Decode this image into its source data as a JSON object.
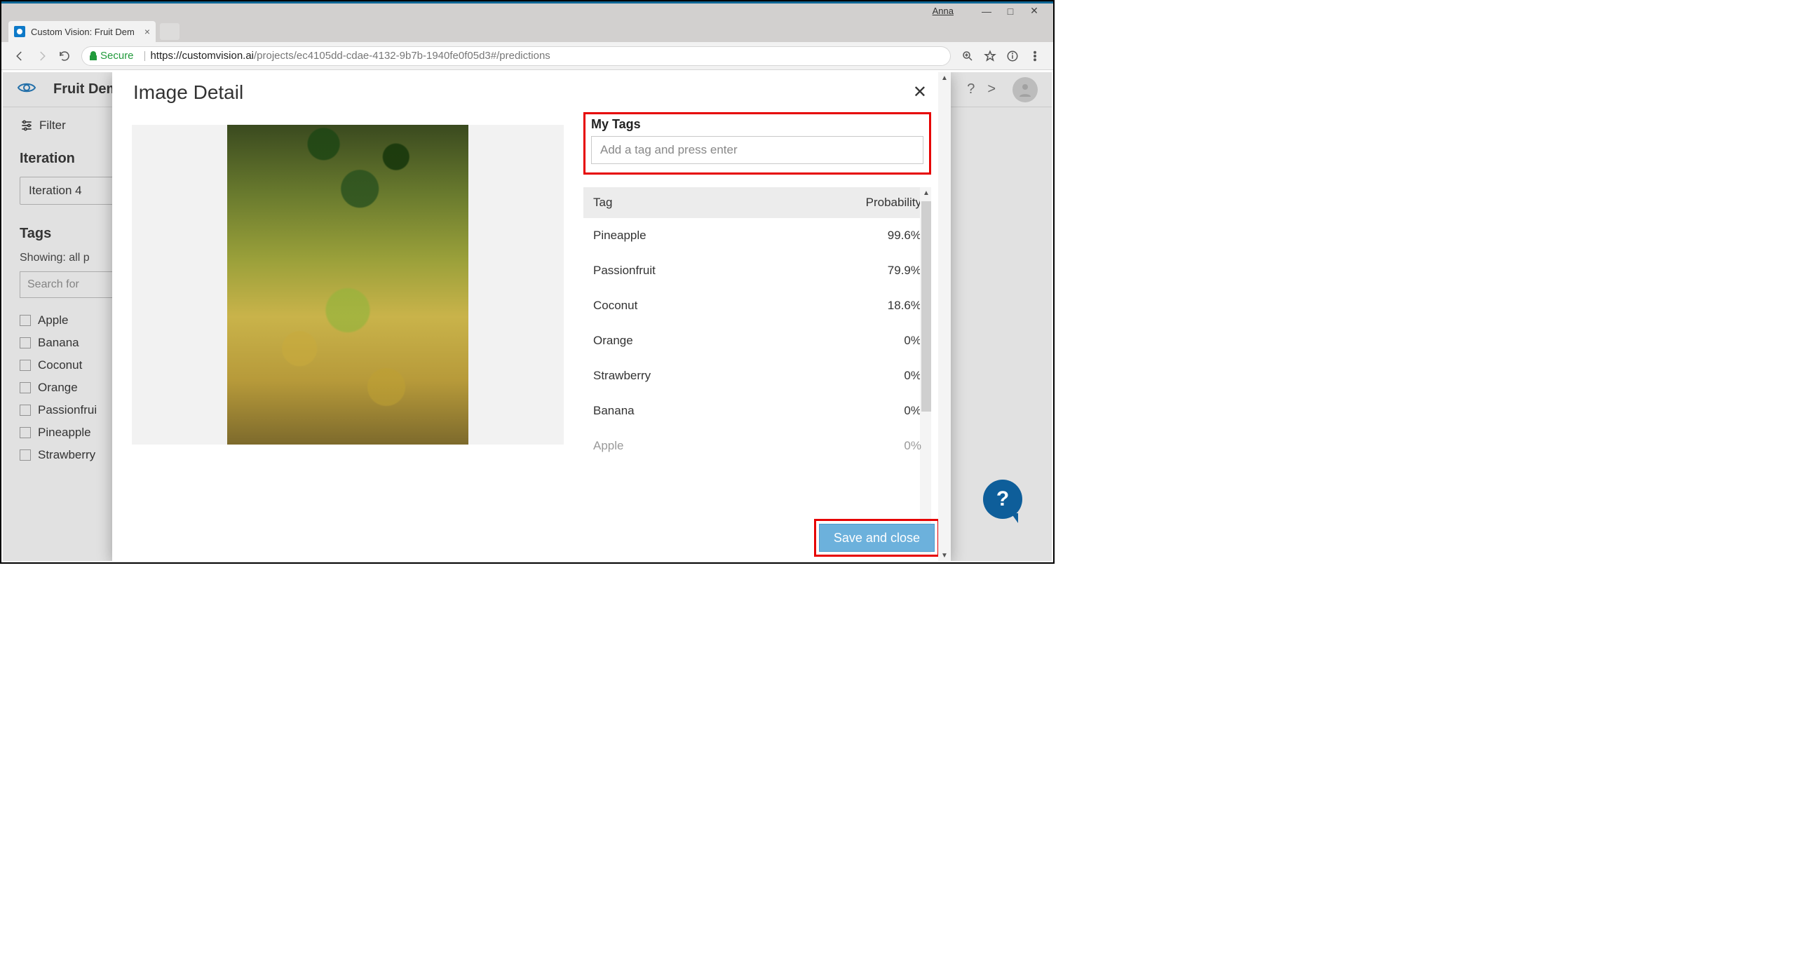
{
  "window": {
    "user": "Anna"
  },
  "browser": {
    "tab_title": "Custom Vision: Fruit Dem",
    "secure_label": "Secure",
    "url_host": "https://customvision.ai",
    "url_path": "/projects/ec4105dd-cdae-4132-9b7b-1940fe0f05d3#/predictions"
  },
  "app": {
    "project_name": "Fruit Dem",
    "breadcrumb_chevron": ">"
  },
  "sidebar": {
    "filter_label": "Filter",
    "iteration_heading": "Iteration",
    "iteration_selected": "Iteration 4",
    "tags_heading": "Tags",
    "showing_label": "Showing: all p",
    "search_placeholder": "Search for",
    "tags": [
      "Apple",
      "Banana",
      "Coconut",
      "Orange",
      "Passionfrui",
      "Pineapple",
      "Strawberry"
    ]
  },
  "modal": {
    "title": "Image Detail",
    "mytags_label": "My Tags",
    "tag_input_placeholder": "Add a tag and press enter",
    "table": {
      "col_tag": "Tag",
      "col_prob": "Probability",
      "rows": [
        {
          "tag": "Pineapple",
          "prob": "99.6%"
        },
        {
          "tag": "Passionfruit",
          "prob": "79.9%"
        },
        {
          "tag": "Coconut",
          "prob": "18.6%"
        },
        {
          "tag": "Orange",
          "prob": "0%"
        },
        {
          "tag": "Strawberry",
          "prob": "0%"
        },
        {
          "tag": "Banana",
          "prob": "0%"
        },
        {
          "tag": "Apple",
          "prob": "0%"
        }
      ]
    },
    "save_label": "Save and close"
  },
  "help": {
    "glyph": "?"
  }
}
